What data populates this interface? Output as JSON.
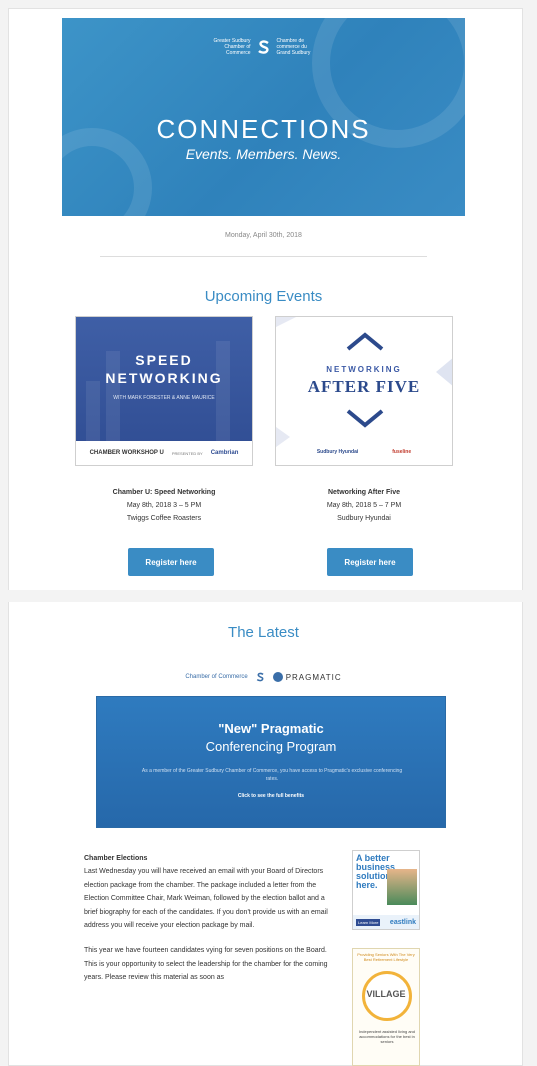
{
  "header": {
    "logo_left": "Greater Sudbury Chamber of Commerce",
    "logo_right": "Chambre de commerce du Grand Sudbury",
    "title": "CONNECTIONS",
    "tagline": "Events. Members. News."
  },
  "date": "Monday, April 30th, 2018",
  "upcoming": {
    "heading": "Upcoming Events",
    "events": [
      {
        "image_title": "SPEED NETWORKING",
        "image_subtitle": "WITH MARK FORESTER & ANNE MAURICE",
        "image_sponsor_left": "CHAMBER WORKSHOP U",
        "image_presented_by": "PRESENTED BY",
        "image_sponsor_right": "Cambrian",
        "name": "Chamber U: Speed Networking",
        "date": "May 8th, 2018 3 – 5 PM",
        "location": "Twiggs Coffee Roasters",
        "button": "Register here"
      },
      {
        "image_title_top": "NETWORKING",
        "image_title_main": "AFTER FIVE",
        "image_sponsor_left": "Sudbury Hyundai",
        "image_sponsor_right": "fuseline",
        "name": "Networking After Five",
        "date": "May 8th, 2018 5 – 7 PM",
        "location": "Sudbury Hyundai",
        "button": "Register here"
      }
    ]
  },
  "latest": {
    "heading": "The Latest",
    "partner_logo_left": "Chamber of Commerce",
    "partner_logo_right": "PRAGMATIC",
    "banner": {
      "title": "\"New\" Pragmatic",
      "subtitle": "Conferencing Program",
      "text": "As a member of the Greater Sudbury Chamber of Commerce, you have access to Pragmatic's exclusive conferencing rates.",
      "cta": "Click to see the full benefits"
    },
    "article": {
      "heading": "Chamber Elections",
      "paragraph1": "Last Wednesday you will have received an email with your Board of Directors election package from the chamber. The package included a letter from the Election Committee Chair, Mark Weiman, followed by the election ballot and a brief biography for each of the candidates. If you don't provide us with an email address you will receive your election package by mail.",
      "paragraph2": "This year we have fourteen candidates vying for seven positions on the Board. This is your opportunity to select the leadership for the chamber for the coming years. Please review this material as soon as"
    }
  },
  "ads": {
    "eastlink": {
      "headline": "A better business solution is here.",
      "button": "Learn More",
      "brand": "eastlink"
    },
    "village": {
      "top": "Providing Seniors With The Very Best Retirement Lifestyle",
      "logo": "VILLAGE",
      "body": "Independent assisted living and accommodations for the best in seniors"
    }
  }
}
